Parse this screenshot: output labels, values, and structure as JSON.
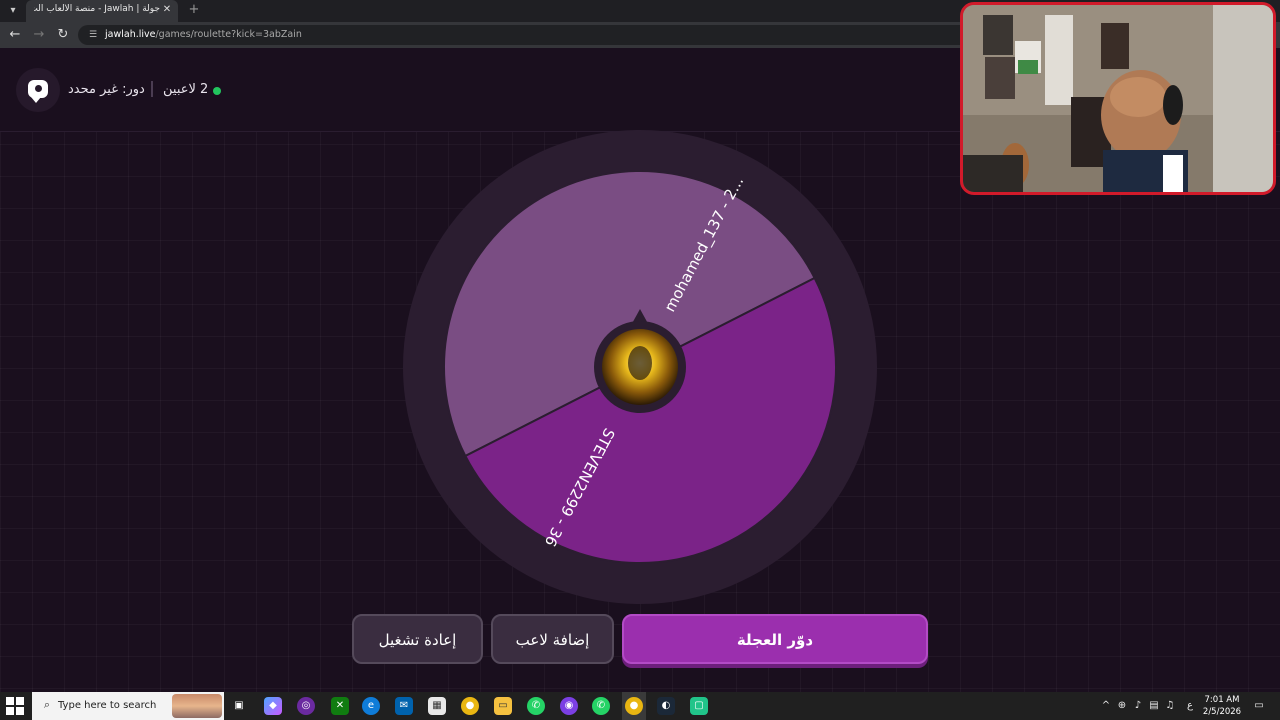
{
  "browser": {
    "tab_title": "جولة | Jawlah - منصة الألعاب الت... ‏",
    "tab_menu_icon": "chevron-down-icon",
    "close_glyph": "✕",
    "new_tab_glyph": "+",
    "back_glyph": "←",
    "forward_glyph": "→",
    "reload_glyph": "↻",
    "url_host": "jawlah.live",
    "url_path": "/games/roulette?kick=3abZain"
  },
  "header": {
    "turn_label": "دور: غير محدد",
    "players_label": "2 لاعبين",
    "online_color": "#22c55e"
  },
  "wheel": {
    "segments": [
      {
        "label": "mohamed_137 - 2...",
        "color": "#7a4d83"
      },
      {
        "label": "STEVEN2299 - 36",
        "color": "#7b2388"
      }
    ],
    "outer_ring_color": "#2b1d30"
  },
  "actions": {
    "spin_label": "دوّر العجلة",
    "add_player_label": "إضافة لاعب",
    "restart_label": "إعادة تشغيل",
    "accent_color": "#9b2fae"
  },
  "taskbar": {
    "search_placeholder": "Type here to search",
    "time": "7:01 AM",
    "date": "2/5/2026",
    "lang": "ع"
  }
}
